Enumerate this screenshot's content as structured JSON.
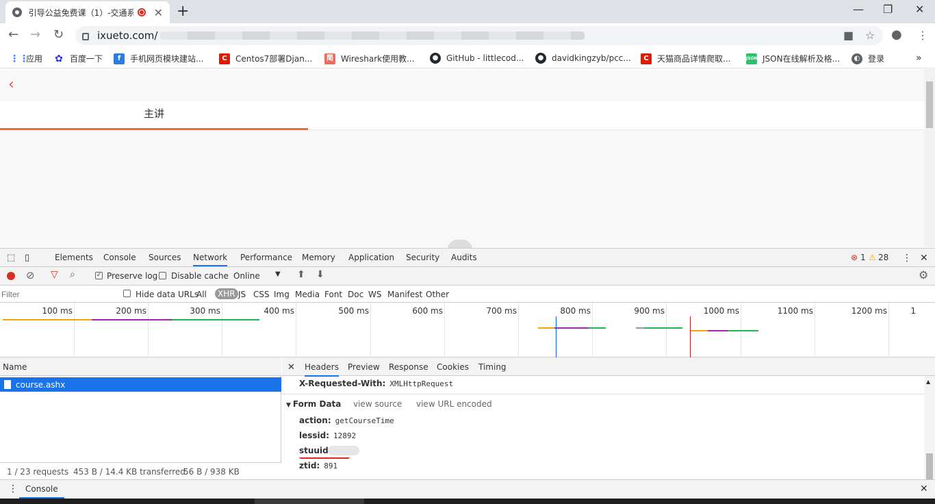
{
  "browser": {
    "tab_title": "引导公益免费课（1）-交通系",
    "url_host": "ixueto.com/",
    "bookmarks": [
      {
        "label": "应用",
        "icon": "apps-grid-icon",
        "color": "#4285f4"
      },
      {
        "label": "百度一下",
        "icon": "baidu-paw-icon",
        "color": "#2932e1"
      },
      {
        "label": "手机网页模块建站...",
        "icon": "f-logo-icon",
        "color": "#2d7de0"
      },
      {
        "label": "Centos7部署Djan...",
        "icon": "csdn-c-icon",
        "color": "#d81e06"
      },
      {
        "label": "Wireshark使用教...",
        "icon": "jianshu-icon",
        "color": "#ea6f5a"
      },
      {
        "label": "GitHub - littlecod...",
        "icon": "github-icon",
        "color": "#24292e"
      },
      {
        "label": "davidkingzyb/pcc...",
        "icon": "github-icon",
        "color": "#24292e"
      },
      {
        "label": "天猫商品详情爬取...",
        "icon": "csdn-c-icon",
        "color": "#d81e06"
      },
      {
        "label": "JSON在线解析及格...",
        "icon": "json-icon",
        "color": "#2fc26b"
      },
      {
        "label": "登录",
        "icon": "globe-icon",
        "color": "#5f6368"
      }
    ]
  },
  "page": {
    "tab_label": "主讲"
  },
  "devtools": {
    "tabs": [
      "Elements",
      "Console",
      "Sources",
      "Network",
      "Performance",
      "Memory",
      "Application",
      "Security",
      "Audits"
    ],
    "active_tab": "Network",
    "error_count": "1",
    "warning_count": "28",
    "preserve_log": "Preserve log",
    "disable_cache": "Disable cache",
    "throttle": "Online",
    "filter_placeholder": "Filter",
    "hide_data_urls": "Hide data URLs",
    "filter_types": [
      "All",
      "XHR",
      "JS",
      "CSS",
      "Img",
      "Media",
      "Font",
      "Doc",
      "WS",
      "Manifest",
      "Other"
    ],
    "active_filter": "XHR",
    "timeline_ticks": [
      "100 ms",
      "200 ms",
      "300 ms",
      "400 ms",
      "500 ms",
      "600 ms",
      "700 ms",
      "800 ms",
      "900 ms",
      "1000 ms",
      "1100 ms",
      "1200 ms",
      "1"
    ],
    "name_header": "Name",
    "requests": [
      {
        "name": "course.ashx"
      }
    ],
    "status": {
      "requests": "1 / 23 requests",
      "transferred": "453 B / 14.4 KB transferred",
      "resources": "56 B / 938 KB resources"
    },
    "detail_tabs": [
      "Headers",
      "Preview",
      "Response",
      "Cookies",
      "Timing"
    ],
    "active_detail_tab": "Headers",
    "request_header": {
      "key": "X-Requested-With:",
      "value": "XMLHttpRequest"
    },
    "form_data": {
      "title": "Form Data",
      "view_source": "view source",
      "view_url_encoded": "view URL encoded",
      "rows": [
        {
          "key": "action:",
          "value": "getCourseTime"
        },
        {
          "key": "lessid:",
          "value": "12892"
        },
        {
          "key": "stuuid:",
          "value": ""
        },
        {
          "key": "ztid:",
          "value": "891"
        }
      ]
    },
    "drawer_tab": "Console"
  }
}
